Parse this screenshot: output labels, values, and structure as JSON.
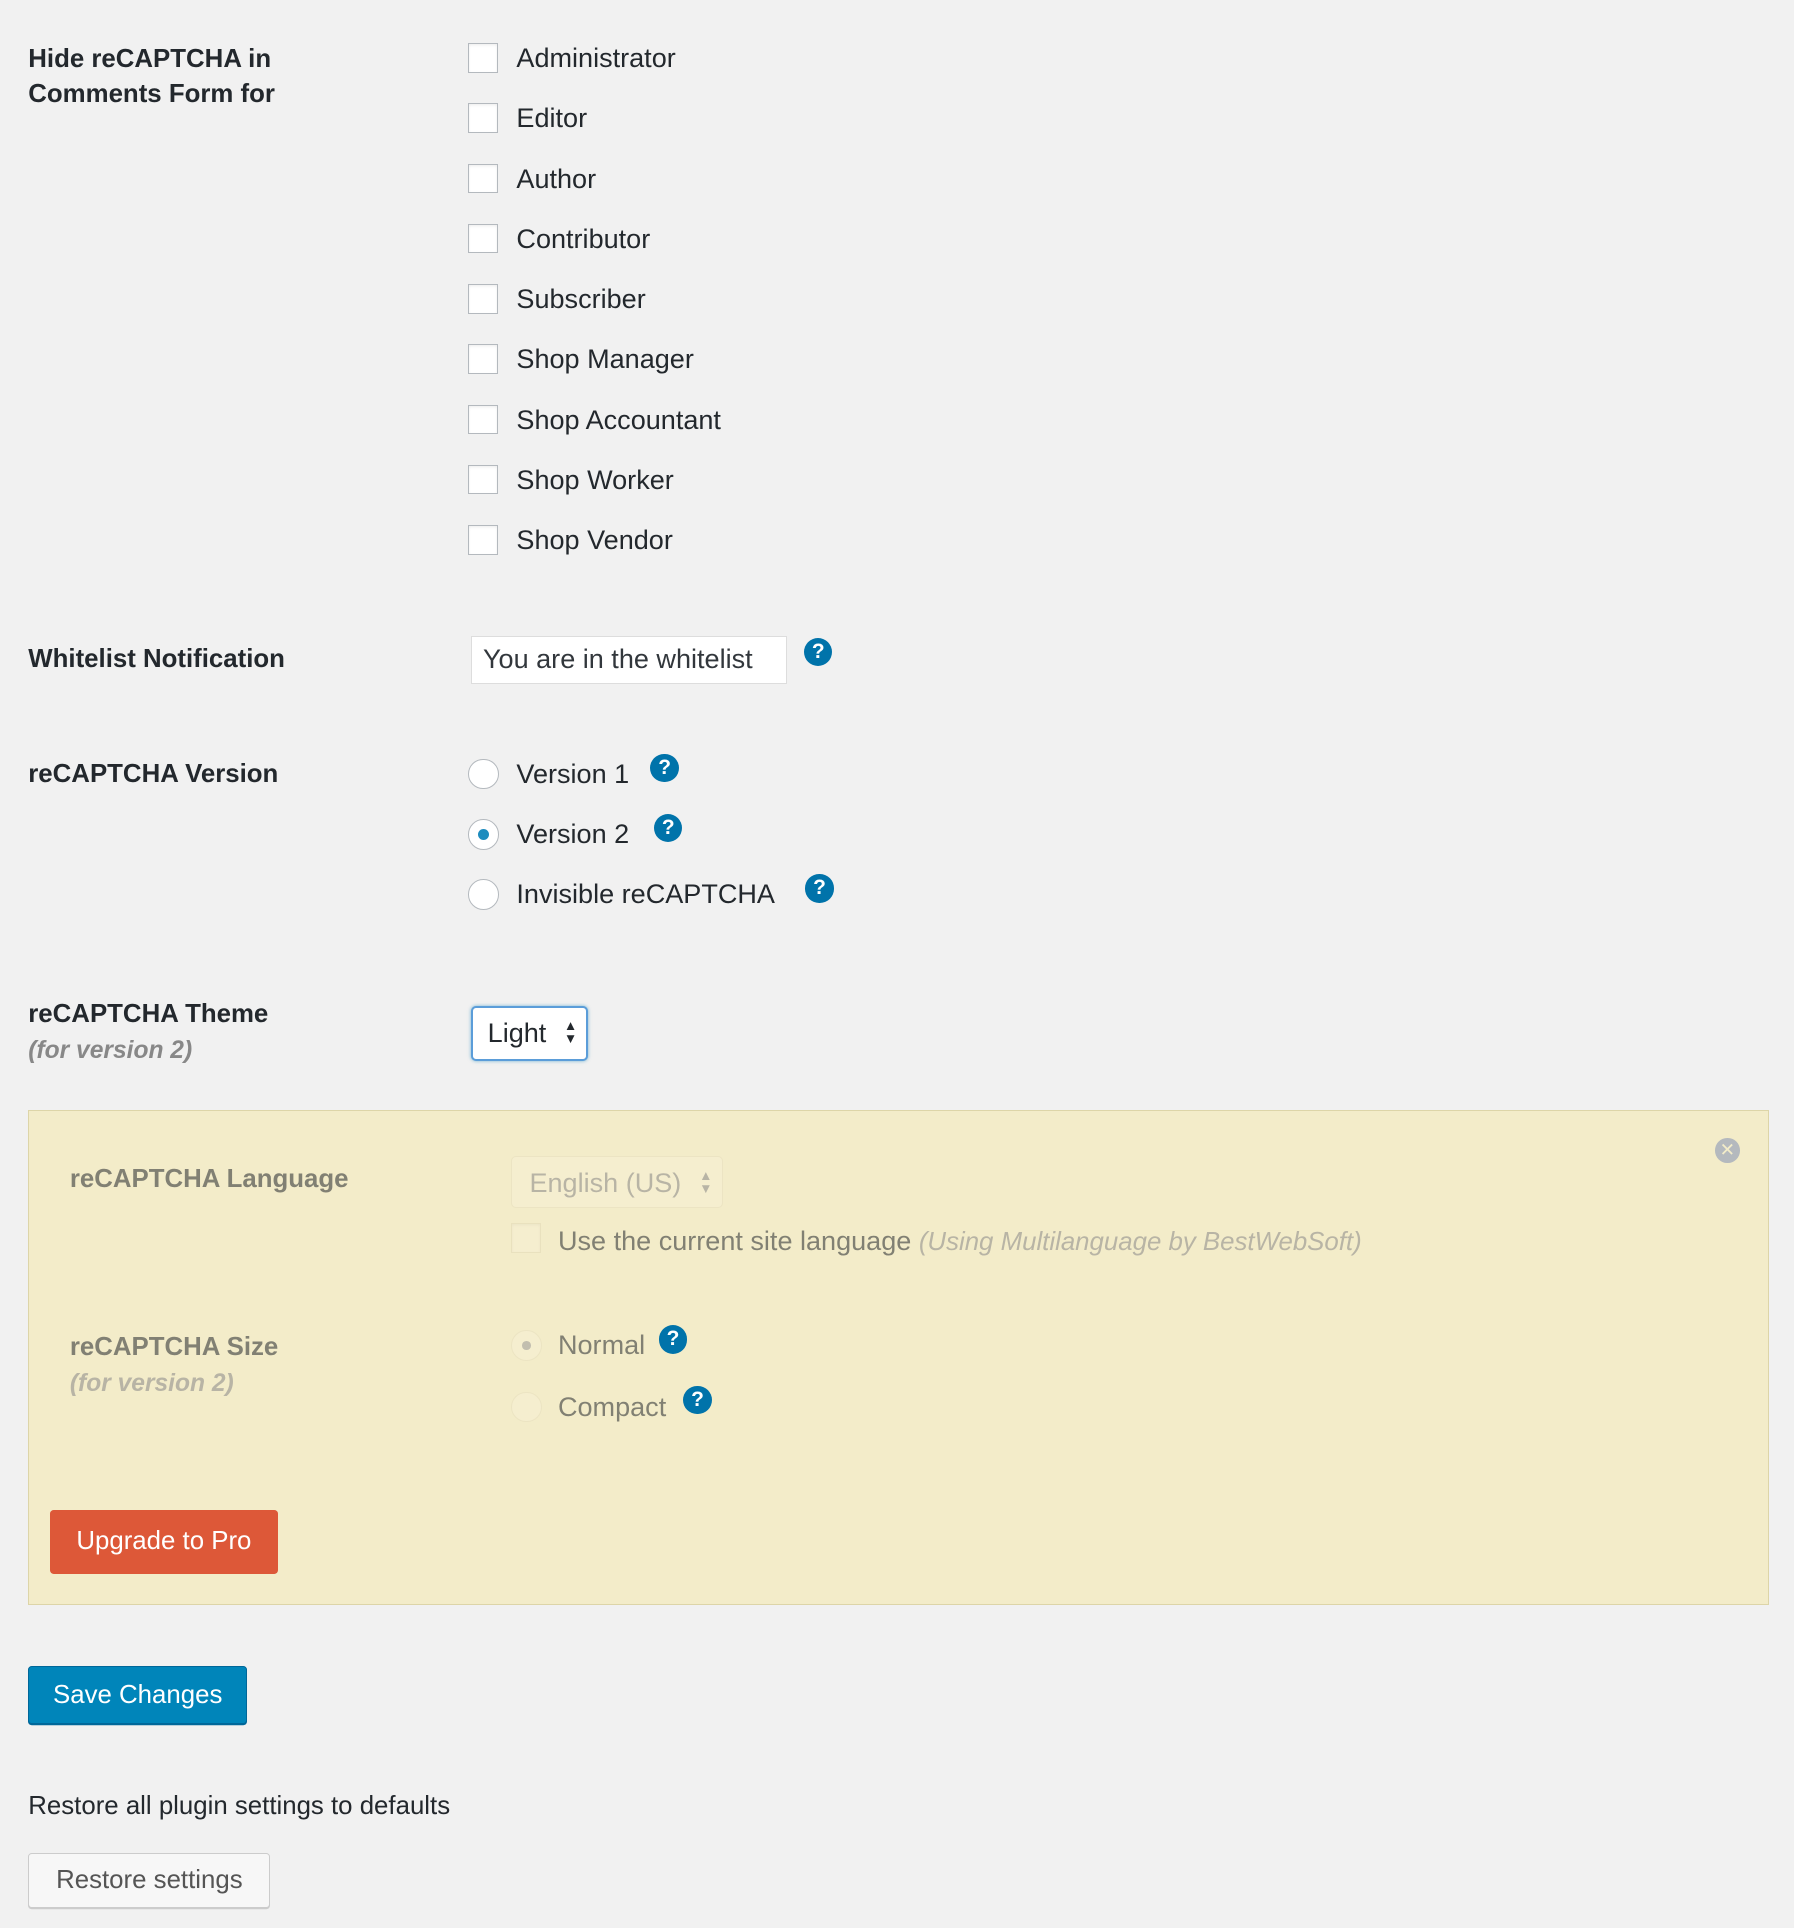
{
  "hide_for": {
    "label": "Hide reCAPTCHA in Comments Form for",
    "roles": [
      "Administrator",
      "Editor",
      "Author",
      "Contributor",
      "Subscriber",
      "Shop Manager",
      "Shop Accountant",
      "Shop Worker",
      "Shop Vendor"
    ]
  },
  "whitelist": {
    "label": "Whitelist Notification",
    "value": "You are in the whitelist",
    "help": "?"
  },
  "version": {
    "label": "reCAPTCHA Version",
    "options": [
      "Version 1",
      "Version 2",
      "Invisible reCAPTCHA"
    ],
    "selected": "Version 2",
    "help": "?"
  },
  "theme": {
    "label": "reCAPTCHA Theme",
    "note": "(for version 2)",
    "value": "Light"
  },
  "pro": {
    "language_label": "reCAPTCHA Language",
    "language_value": "English (US)",
    "site_language_label": "Use the current site language",
    "site_language_note": "(Using Multilanguage by BestWebSoft)",
    "size_label": "reCAPTCHA Size",
    "size_note": "(for version 2)",
    "size_options": [
      "Normal",
      "Compact"
    ],
    "size_selected": "Normal",
    "upgrade_label": "Upgrade to Pro",
    "close_icon": "close-circle-icon"
  },
  "save_label": "Save Changes",
  "restore": {
    "text": "Restore all plugin settings to defaults",
    "button": "Restore settings"
  },
  "colors": {
    "accent": "#0085ba",
    "upgrade": "#dd5838",
    "pro_bg": "#f3ecc9"
  }
}
